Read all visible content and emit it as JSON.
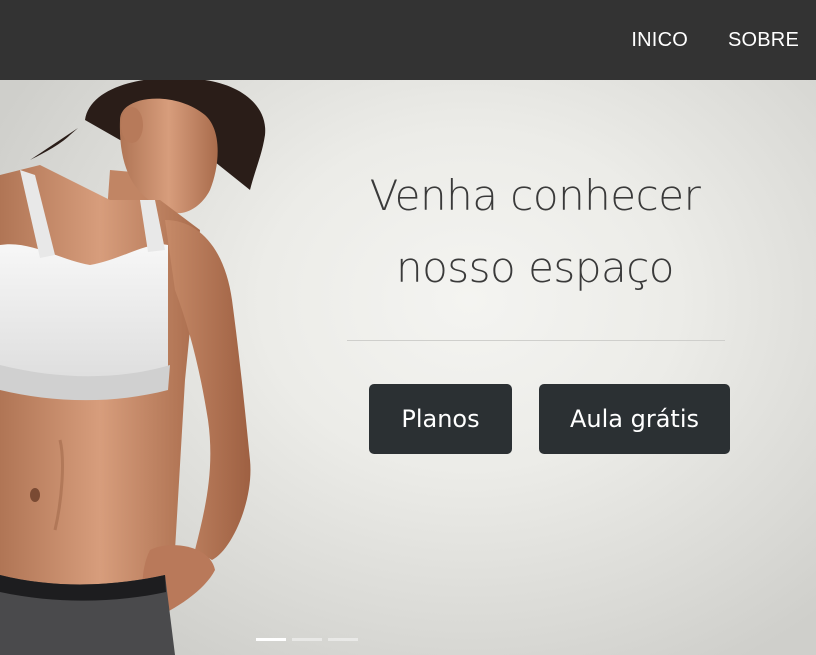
{
  "nav": {
    "items": [
      {
        "label": "INICO"
      },
      {
        "label": "SOBRE"
      }
    ]
  },
  "hero": {
    "title_line1": "Venha conhecer",
    "title_line2": "nosso espaço",
    "buttons": {
      "planos": "Planos",
      "aula": "Aula grátis"
    },
    "carousel": {
      "slide_count": 3,
      "active_index": 0
    }
  },
  "colors": {
    "navbar_bg": "#333333",
    "button_bg": "#2b3033",
    "title_text": "#3a3a3a"
  }
}
